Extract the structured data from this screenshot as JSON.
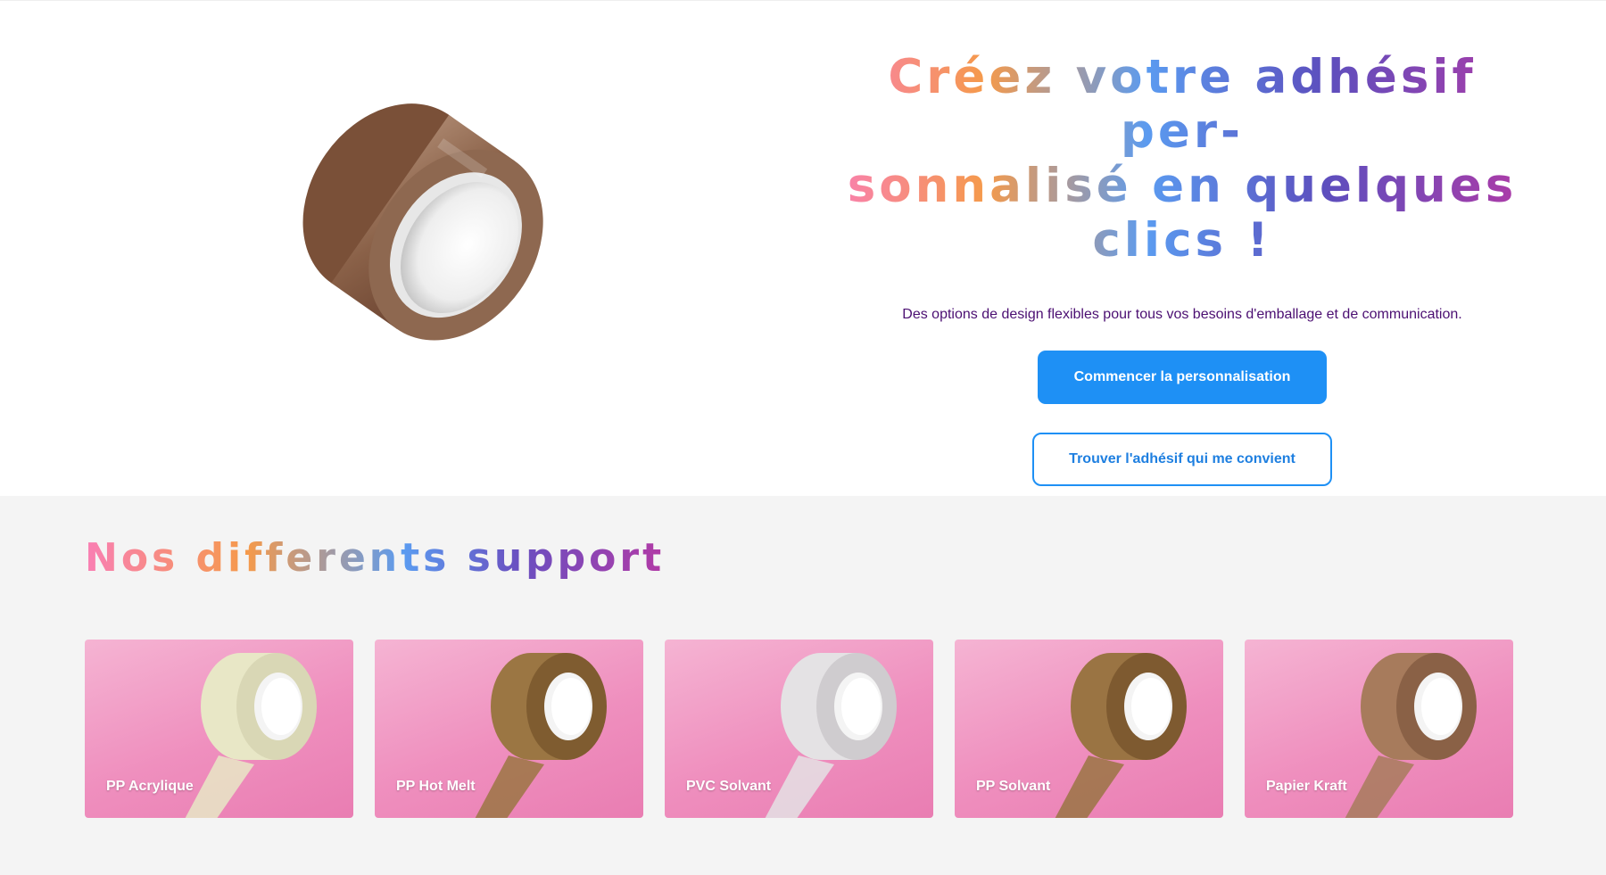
{
  "hero": {
    "title": "Créez votre adhésif per-sonnalisé en quelques clics !",
    "title_lines": [
      "Créez votre adhésif per-",
      "sonnalisé en quelques",
      "clics !"
    ],
    "subtitle": "Des options de design flexibles pour tous vos besoins d'emballage et de communication.",
    "primary_button": "Commencer la personnalisation",
    "secondary_button": "Trouver l'adhésif qui me convient",
    "image_icon": "brown-tape-roll-image"
  },
  "supports": {
    "title": "Nos differents support",
    "cards": [
      {
        "label": "PP Acrylique",
        "tape_color": "#e8e7c6"
      },
      {
        "label": "PP Hot Melt",
        "tape_color": "#9b7643"
      },
      {
        "label": "PVC Solvant",
        "tape_color": "#e4e2e4"
      },
      {
        "label": "PP Solvant",
        "tape_color": "#9a7443"
      },
      {
        "label": "Papier Kraft",
        "tape_color": "#a77b5c"
      }
    ]
  },
  "colors": {
    "primary": "#1e90f5",
    "subtitle": "#4b0f72",
    "card_background": "#ef8fbe",
    "section_background": "#f4f4f4"
  }
}
